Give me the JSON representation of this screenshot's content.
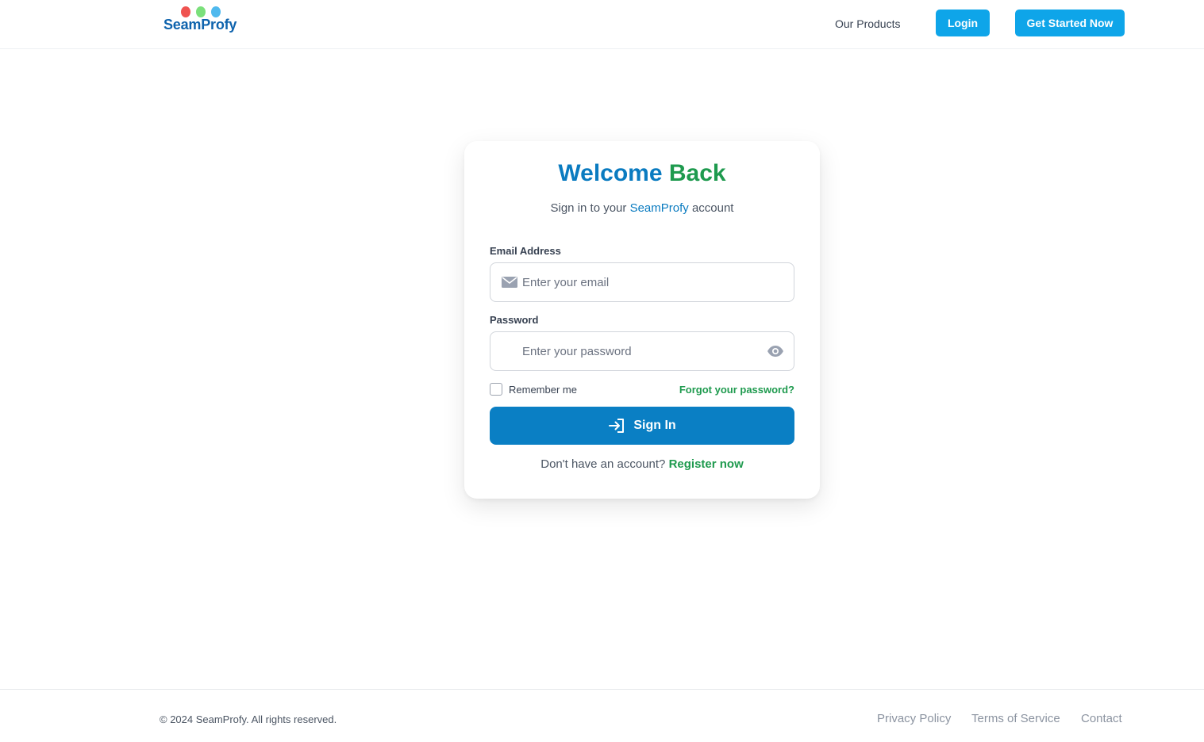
{
  "header": {
    "logo_text": "SeamProfy",
    "nav_products": "Our Products",
    "login_label": "Login",
    "get_started_label": "Get Started Now"
  },
  "login_card": {
    "title_part1": "Welcome",
    "title_part2": "Back",
    "subtitle_prefix": "Sign in to your",
    "subtitle_brand": "SeamProfy",
    "subtitle_suffix": "account",
    "email_label": "Email Address",
    "email_placeholder": "Enter your email",
    "email_value": "",
    "password_label": "Password",
    "password_placeholder": "Enter your password",
    "password_value": "",
    "remember_label": "Remember me",
    "remember_checked": false,
    "forgot_label": "Forgot your password?",
    "signin_label": "Sign In",
    "register_prompt": "Don't have an account?",
    "register_link": "Register now"
  },
  "icons": {
    "email": "mail-icon",
    "password_toggle": "eye-icon",
    "signin": "sign-in-arrow-icon"
  },
  "colors": {
    "primary": "#0a7fc4",
    "accent_green": "#1e9a4e",
    "header_button": "#0ea5e9"
  },
  "footer": {
    "copyright": "© 2024 SeamProfy. All rights reserved.",
    "links": [
      "Privacy Policy",
      "Terms of Service",
      "Contact"
    ]
  }
}
